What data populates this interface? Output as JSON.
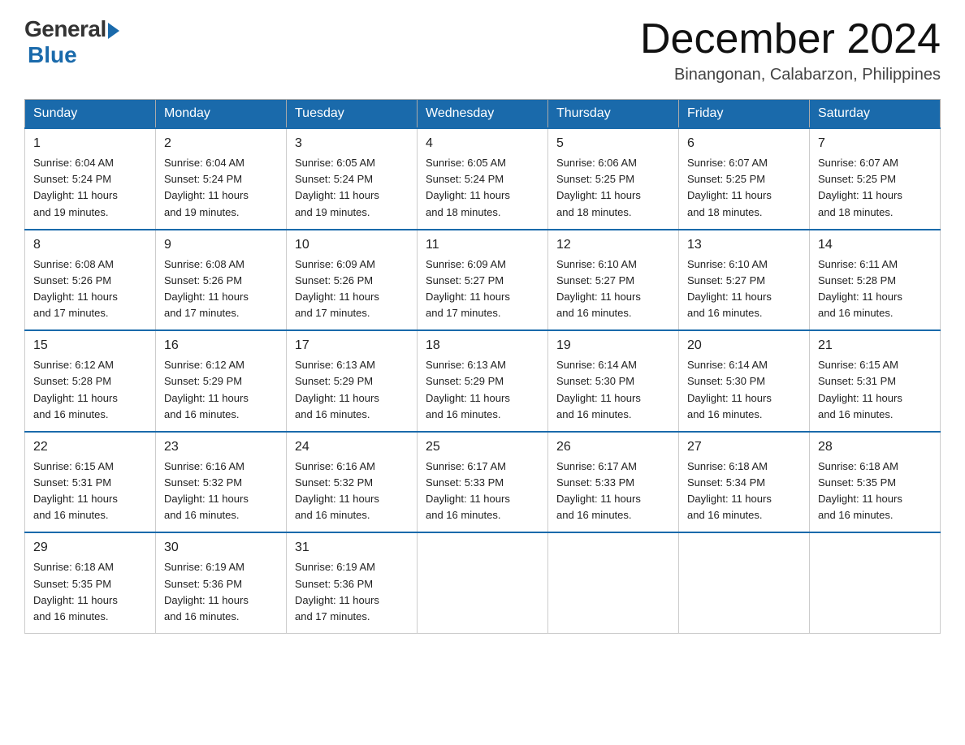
{
  "header": {
    "logo_general": "General",
    "logo_blue": "Blue",
    "title": "December 2024",
    "location": "Binangonan, Calabarzon, Philippines"
  },
  "weekdays": [
    "Sunday",
    "Monday",
    "Tuesday",
    "Wednesday",
    "Thursday",
    "Friday",
    "Saturday"
  ],
  "weeks": [
    [
      {
        "num": "1",
        "sunrise": "6:04 AM",
        "sunset": "5:24 PM",
        "daylight": "11 hours and 19 minutes."
      },
      {
        "num": "2",
        "sunrise": "6:04 AM",
        "sunset": "5:24 PM",
        "daylight": "11 hours and 19 minutes."
      },
      {
        "num": "3",
        "sunrise": "6:05 AM",
        "sunset": "5:24 PM",
        "daylight": "11 hours and 19 minutes."
      },
      {
        "num": "4",
        "sunrise": "6:05 AM",
        "sunset": "5:24 PM",
        "daylight": "11 hours and 18 minutes."
      },
      {
        "num": "5",
        "sunrise": "6:06 AM",
        "sunset": "5:25 PM",
        "daylight": "11 hours and 18 minutes."
      },
      {
        "num": "6",
        "sunrise": "6:07 AM",
        "sunset": "5:25 PM",
        "daylight": "11 hours and 18 minutes."
      },
      {
        "num": "7",
        "sunrise": "6:07 AM",
        "sunset": "5:25 PM",
        "daylight": "11 hours and 18 minutes."
      }
    ],
    [
      {
        "num": "8",
        "sunrise": "6:08 AM",
        "sunset": "5:26 PM",
        "daylight": "11 hours and 17 minutes."
      },
      {
        "num": "9",
        "sunrise": "6:08 AM",
        "sunset": "5:26 PM",
        "daylight": "11 hours and 17 minutes."
      },
      {
        "num": "10",
        "sunrise": "6:09 AM",
        "sunset": "5:26 PM",
        "daylight": "11 hours and 17 minutes."
      },
      {
        "num": "11",
        "sunrise": "6:09 AM",
        "sunset": "5:27 PM",
        "daylight": "11 hours and 17 minutes."
      },
      {
        "num": "12",
        "sunrise": "6:10 AM",
        "sunset": "5:27 PM",
        "daylight": "11 hours and 16 minutes."
      },
      {
        "num": "13",
        "sunrise": "6:10 AM",
        "sunset": "5:27 PM",
        "daylight": "11 hours and 16 minutes."
      },
      {
        "num": "14",
        "sunrise": "6:11 AM",
        "sunset": "5:28 PM",
        "daylight": "11 hours and 16 minutes."
      }
    ],
    [
      {
        "num": "15",
        "sunrise": "6:12 AM",
        "sunset": "5:28 PM",
        "daylight": "11 hours and 16 minutes."
      },
      {
        "num": "16",
        "sunrise": "6:12 AM",
        "sunset": "5:29 PM",
        "daylight": "11 hours and 16 minutes."
      },
      {
        "num": "17",
        "sunrise": "6:13 AM",
        "sunset": "5:29 PM",
        "daylight": "11 hours and 16 minutes."
      },
      {
        "num": "18",
        "sunrise": "6:13 AM",
        "sunset": "5:29 PM",
        "daylight": "11 hours and 16 minutes."
      },
      {
        "num": "19",
        "sunrise": "6:14 AM",
        "sunset": "5:30 PM",
        "daylight": "11 hours and 16 minutes."
      },
      {
        "num": "20",
        "sunrise": "6:14 AM",
        "sunset": "5:30 PM",
        "daylight": "11 hours and 16 minutes."
      },
      {
        "num": "21",
        "sunrise": "6:15 AM",
        "sunset": "5:31 PM",
        "daylight": "11 hours and 16 minutes."
      }
    ],
    [
      {
        "num": "22",
        "sunrise": "6:15 AM",
        "sunset": "5:31 PM",
        "daylight": "11 hours and 16 minutes."
      },
      {
        "num": "23",
        "sunrise": "6:16 AM",
        "sunset": "5:32 PM",
        "daylight": "11 hours and 16 minutes."
      },
      {
        "num": "24",
        "sunrise": "6:16 AM",
        "sunset": "5:32 PM",
        "daylight": "11 hours and 16 minutes."
      },
      {
        "num": "25",
        "sunrise": "6:17 AM",
        "sunset": "5:33 PM",
        "daylight": "11 hours and 16 minutes."
      },
      {
        "num": "26",
        "sunrise": "6:17 AM",
        "sunset": "5:33 PM",
        "daylight": "11 hours and 16 minutes."
      },
      {
        "num": "27",
        "sunrise": "6:18 AM",
        "sunset": "5:34 PM",
        "daylight": "11 hours and 16 minutes."
      },
      {
        "num": "28",
        "sunrise": "6:18 AM",
        "sunset": "5:35 PM",
        "daylight": "11 hours and 16 minutes."
      }
    ],
    [
      {
        "num": "29",
        "sunrise": "6:18 AM",
        "sunset": "5:35 PM",
        "daylight": "11 hours and 16 minutes."
      },
      {
        "num": "30",
        "sunrise": "6:19 AM",
        "sunset": "5:36 PM",
        "daylight": "11 hours and 16 minutes."
      },
      {
        "num": "31",
        "sunrise": "6:19 AM",
        "sunset": "5:36 PM",
        "daylight": "11 hours and 17 minutes."
      },
      null,
      null,
      null,
      null
    ]
  ]
}
